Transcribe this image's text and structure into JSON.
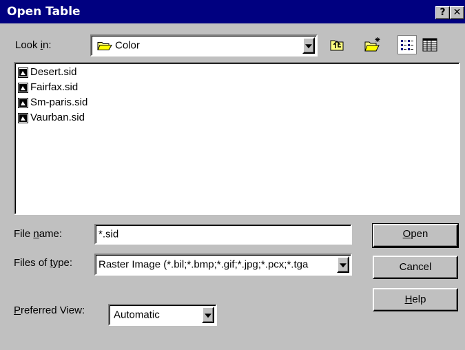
{
  "window": {
    "title": "Open Table",
    "help_button": "?",
    "close_button": "✕"
  },
  "look_in": {
    "label_pre": "Look ",
    "label_mnemonic": "i",
    "label_post": "n:",
    "value": "Color"
  },
  "toolbar": {
    "icons": [
      "up-one-level-icon",
      "create-new-folder-icon",
      "list-view-icon",
      "details-view-icon"
    ]
  },
  "files": [
    {
      "name": "Desert.sid"
    },
    {
      "name": "Fairfax.sid"
    },
    {
      "name": "Sm-paris.sid"
    },
    {
      "name": "Vaurban.sid"
    }
  ],
  "file_name": {
    "label_pre": "File ",
    "label_mnemonic": "n",
    "label_post": "ame:",
    "value": "*.sid"
  },
  "files_of_type": {
    "label_pre": "Files of ",
    "label_mnemonic": "t",
    "label_post": "ype:",
    "value": "Raster Image (*.bil;*.bmp;*.gif;*.jpg;*.pcx;*.tga"
  },
  "preferred_view": {
    "label_mnemonic": "P",
    "label_post": "referred View:",
    "value": "Automatic"
  },
  "buttons": {
    "open_mnemonic": "O",
    "open_rest": "pen",
    "cancel": "Cancel",
    "help_mnemonic": "H",
    "help_rest": "elp"
  }
}
